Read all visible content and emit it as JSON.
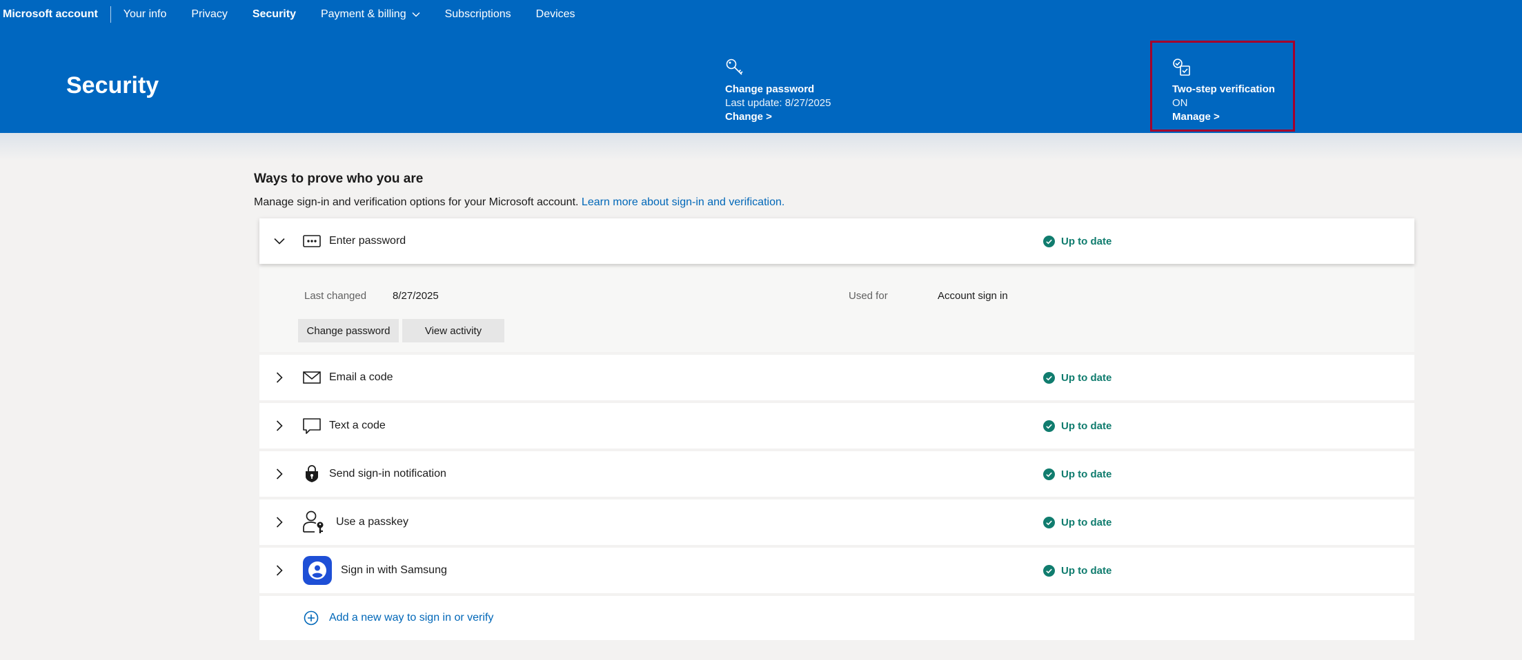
{
  "nav": {
    "brand": "Microsoft account",
    "links": [
      {
        "label": "Your info",
        "active": false
      },
      {
        "label": "Privacy",
        "active": false
      },
      {
        "label": "Security",
        "active": true
      },
      {
        "label": "Payment & billing",
        "active": false,
        "dropdown": true
      },
      {
        "label": "Subscriptions",
        "active": false
      },
      {
        "label": "Devices",
        "active": false
      }
    ]
  },
  "header": {
    "title": "Security",
    "change_password": {
      "icon": "key-icon",
      "title": "Change password",
      "subtitle": "Last update: 8/27/2025",
      "link": "Change >"
    },
    "two_step": {
      "icon": "checklist-icon",
      "title": "Two-step verification",
      "status": "ON",
      "link": "Manage >"
    }
  },
  "section": {
    "title": "Ways to prove who you are",
    "description": "Manage sign-in and verification options for your Microsoft account.",
    "learn_more": "Learn more about sign-in and verification."
  },
  "methods": {
    "password": {
      "label": "Enter password",
      "status": "Up to date",
      "icon": "password-icon",
      "details": {
        "last_changed_label": "Last changed",
        "last_changed_value": "8/27/2025",
        "used_for_label": "Used for",
        "used_for_value": "Account sign in",
        "change_button": "Change password",
        "activity_button": "View activity"
      }
    },
    "email": {
      "label": "Email a code",
      "status": "Up to date",
      "icon": "mail-icon"
    },
    "text": {
      "label": "Text a code",
      "status": "Up to date",
      "icon": "chat-icon"
    },
    "notification": {
      "label": "Send sign-in notification",
      "status": "Up to date",
      "icon": "lock-shield-icon"
    },
    "passkey": {
      "label": "Use a passkey",
      "status": "Up to date",
      "icon": "passkey-icon"
    },
    "samsung": {
      "label": "Sign in with Samsung",
      "status": "Up to date",
      "icon": "samsung-icon"
    },
    "add": {
      "label": "Add a new way to sign in or verify",
      "icon": "plus-circle-icon"
    }
  },
  "colors": {
    "header_blue": "#0067c0",
    "status_green": "#107c6e",
    "link_blue": "#0067b8",
    "highlight_border": "#a4002c"
  }
}
